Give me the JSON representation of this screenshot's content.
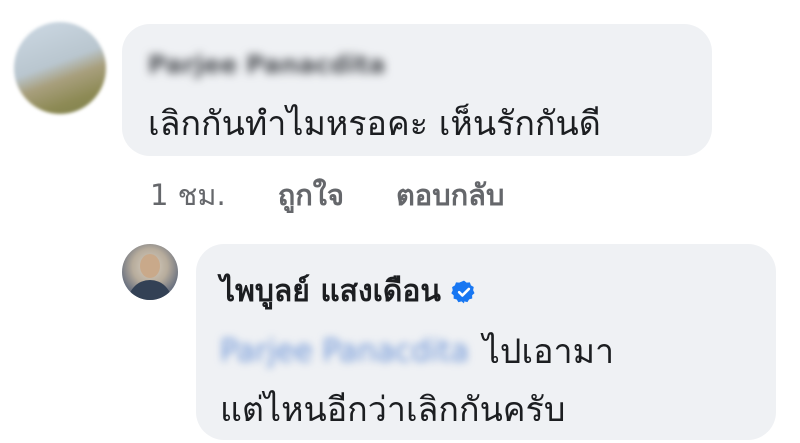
{
  "comment": {
    "author_name": "Parjee Panacdita",
    "text": "เลิกกันทำไมหรอคะ เห็นรักกันดี",
    "timestamp": "1 ชม.",
    "like_label": "ถูกใจ",
    "reply_label": "ตอบกลับ"
  },
  "reply": {
    "author_name": "ไพบูลย์ แสงเดือน",
    "verified": true,
    "verified_color": "#1877f2",
    "mention": "Parjee Panacdita",
    "text_line_1": "ไปเอามา",
    "text_line_2": "แต่ไหนอีกว่าเลิกกันครับ"
  },
  "colors": {
    "bubble_bg": "#eff1f4",
    "text": "#1c1e21",
    "meta_text": "#65676b",
    "mention": "#6b93d6"
  }
}
